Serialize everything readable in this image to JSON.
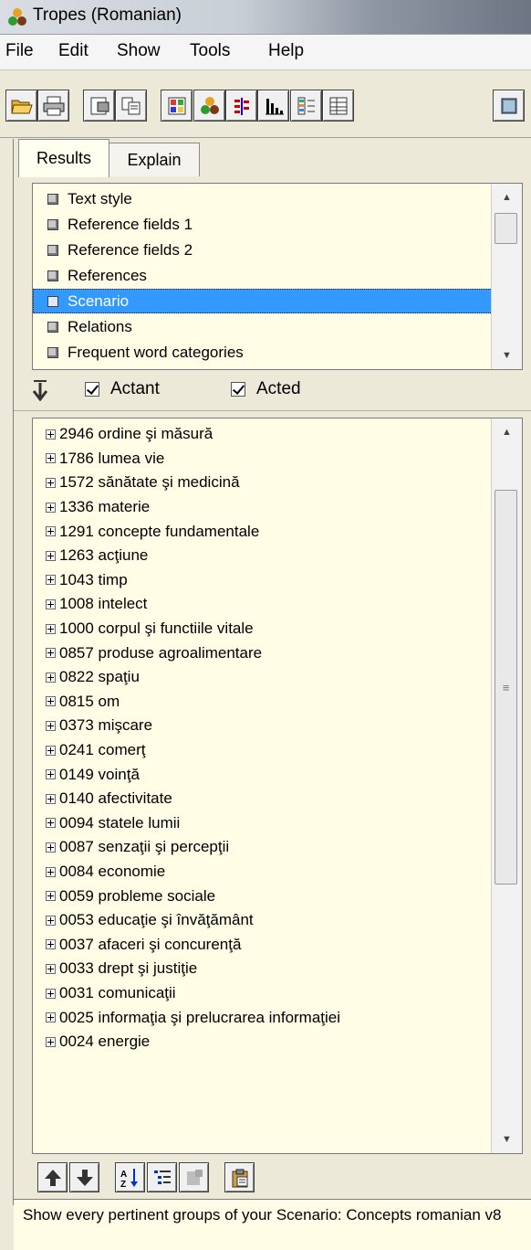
{
  "window": {
    "title": "Tropes (Romanian)"
  },
  "menu": [
    "File",
    "Edit",
    "Show",
    "Tools",
    "Help"
  ],
  "toolbar_icons": [
    "open-folder-icon",
    "print-icon",
    "properties-icon",
    "copy-icon",
    "grid-icon",
    "scenario-icon",
    "bars-icon",
    "chart-icon",
    "tree-icon",
    "table-icon",
    "database-icon"
  ],
  "tabs": {
    "results": "Results",
    "explain": "Explain"
  },
  "result_items": [
    {
      "label": "Text style",
      "selected": false
    },
    {
      "label": "Reference fields 1",
      "selected": false
    },
    {
      "label": "Reference fields 2",
      "selected": false
    },
    {
      "label": "References",
      "selected": false
    },
    {
      "label": "Scenario",
      "selected": true
    },
    {
      "label": "Relations",
      "selected": false
    },
    {
      "label": "Frequent word categories",
      "selected": false
    }
  ],
  "filters": {
    "actant_label": "Actant",
    "actant_checked": true,
    "acted_label": "Acted",
    "acted_checked": true
  },
  "tree_items": [
    "2946 ordine şi măsură",
    "1786 lumea vie",
    "1572 sănătate şi medicină",
    "1336 materie",
    "1291 concepte fundamentale",
    "1263 acţiune",
    "1043 timp",
    "1008 intelect",
    "1000 corpul şi functiile vitale",
    "0857 produse agroalimentare",
    "0822 spaţiu",
    "0815 om",
    "0373 mişcare",
    "0241 comerţ",
    "0149 voinţă",
    "0140 afectivitate",
    "0094 statele lumii",
    "0087 senzaţii şi percepţii",
    "0084 economie",
    "0059 probleme sociale",
    "0053 educaţie şi învăţământ",
    "0037 afaceri şi concurenţă",
    "0033 drept şi justiţie",
    "0031 comunicaţii",
    "0025 informaţia şi prelucrarea informaţiei",
    "0024 energie"
  ],
  "bottom_toolbar_icons": [
    "move-up-icon",
    "move-down-icon",
    "sort-az-icon",
    "outline-icon",
    "disabled-tool-icon",
    "paste-icon"
  ],
  "status_text": "Show every pertinent groups of your Scenario: Concepts romanian v8"
}
